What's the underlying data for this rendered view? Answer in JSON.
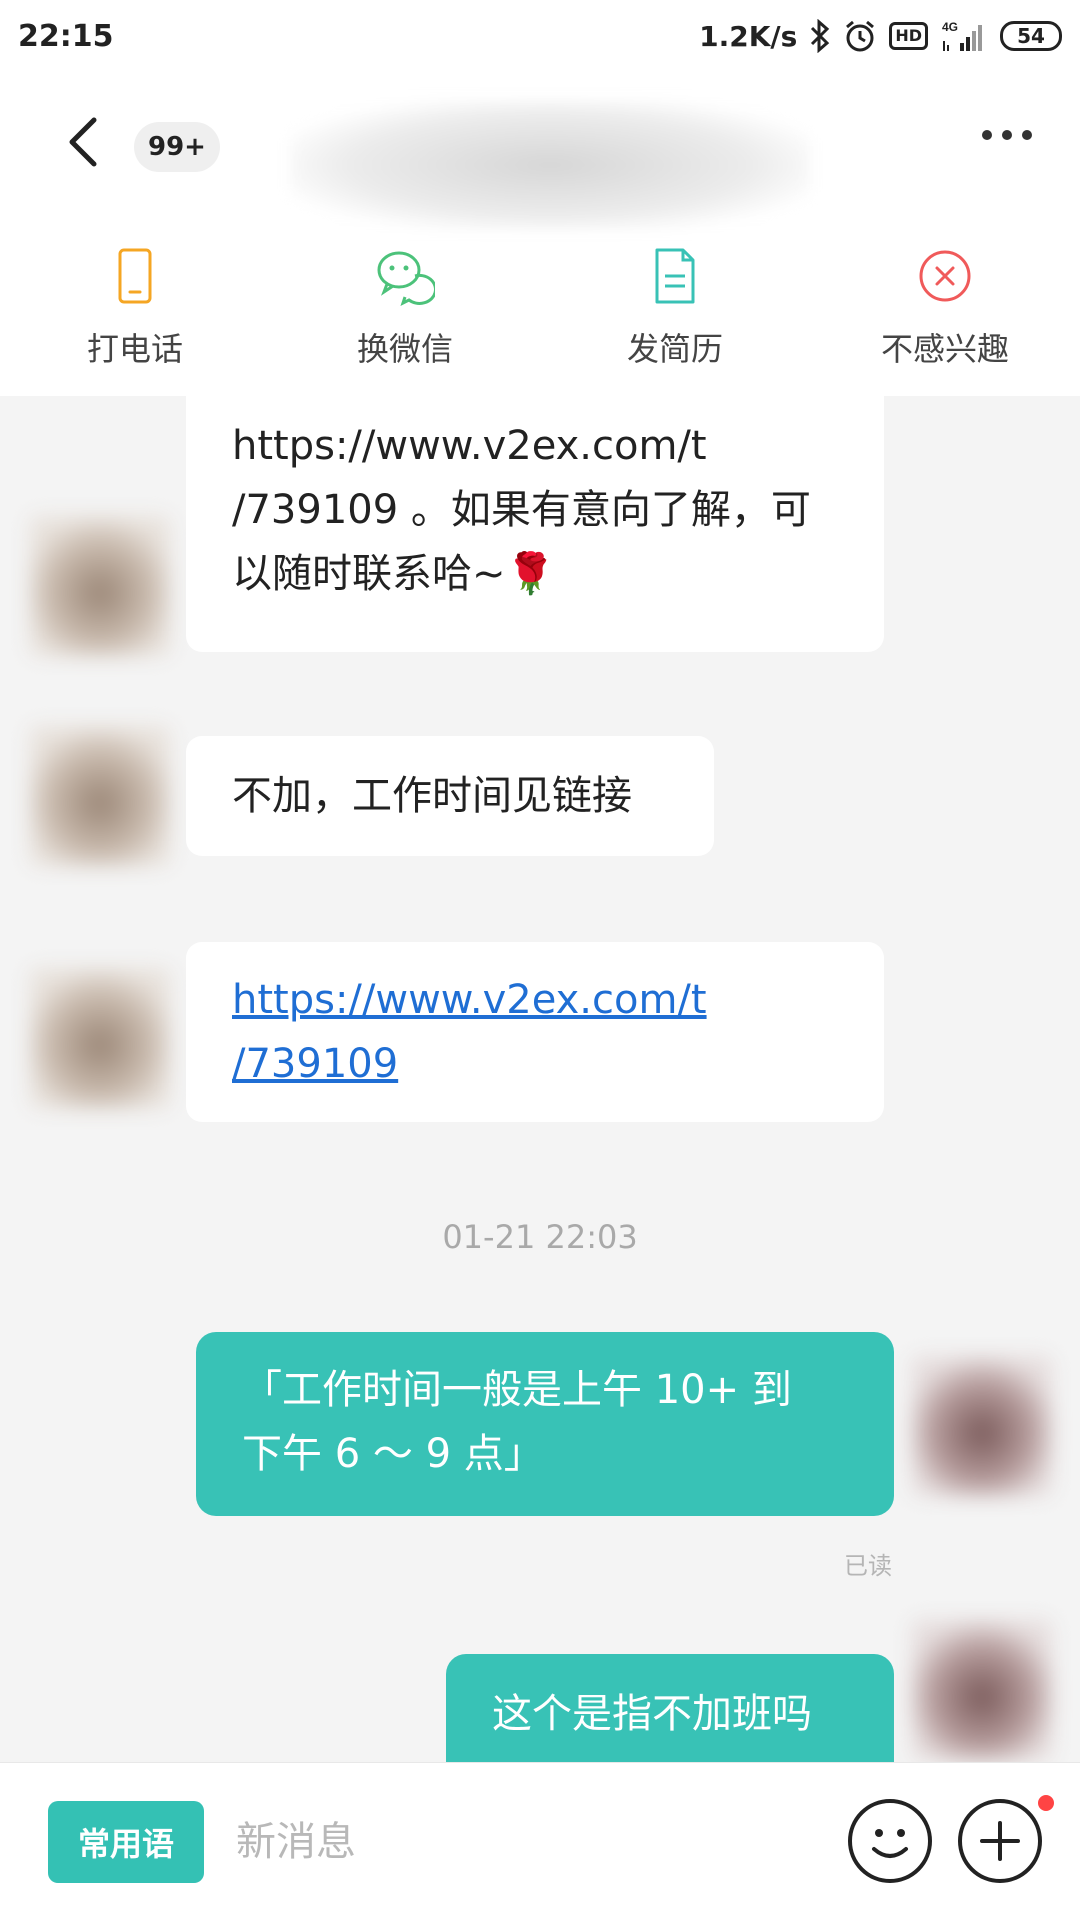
{
  "status_bar": {
    "time": "22:15",
    "speed": "1.2K/s",
    "hd": "HD",
    "network": "4G",
    "battery": "54"
  },
  "header": {
    "unread_badge": "99+"
  },
  "actions": [
    {
      "label": "打电话",
      "icon": "phone-icon",
      "color": "#f5a623"
    },
    {
      "label": "换微信",
      "icon": "wechat-icon",
      "color": "#4cc27a"
    },
    {
      "label": "发简历",
      "icon": "resume-icon",
      "color": "#38c2b6"
    },
    {
      "label": "不感兴趣",
      "icon": "not-interested-icon",
      "color": "#f05a5a"
    }
  ],
  "messages": {
    "m1_line1": "https://www.v2ex.com/t",
    "m1_line2": "/739109 。如果有意向了解，可",
    "m1_line3": "以随时联系哈~🌹",
    "m2": "不加，工作时间见链接",
    "m3_line1": "https://www.v2ex.com/t",
    "m3_line2": "/739109",
    "timestamp": "01-21 22:03",
    "m4_line1": "「工作时间一般是上午 10+ 到",
    "m4_line2": "下午 6 ～ 9 点」",
    "m4_read": "已读",
    "m5": "这个是指不加班吗"
  },
  "bottom": {
    "phrases_label": "常用语",
    "input_placeholder": "新消息"
  },
  "colors": {
    "accent": "#38c2b6",
    "link": "#1f6ed4",
    "notification_dot": "#ff4444"
  }
}
